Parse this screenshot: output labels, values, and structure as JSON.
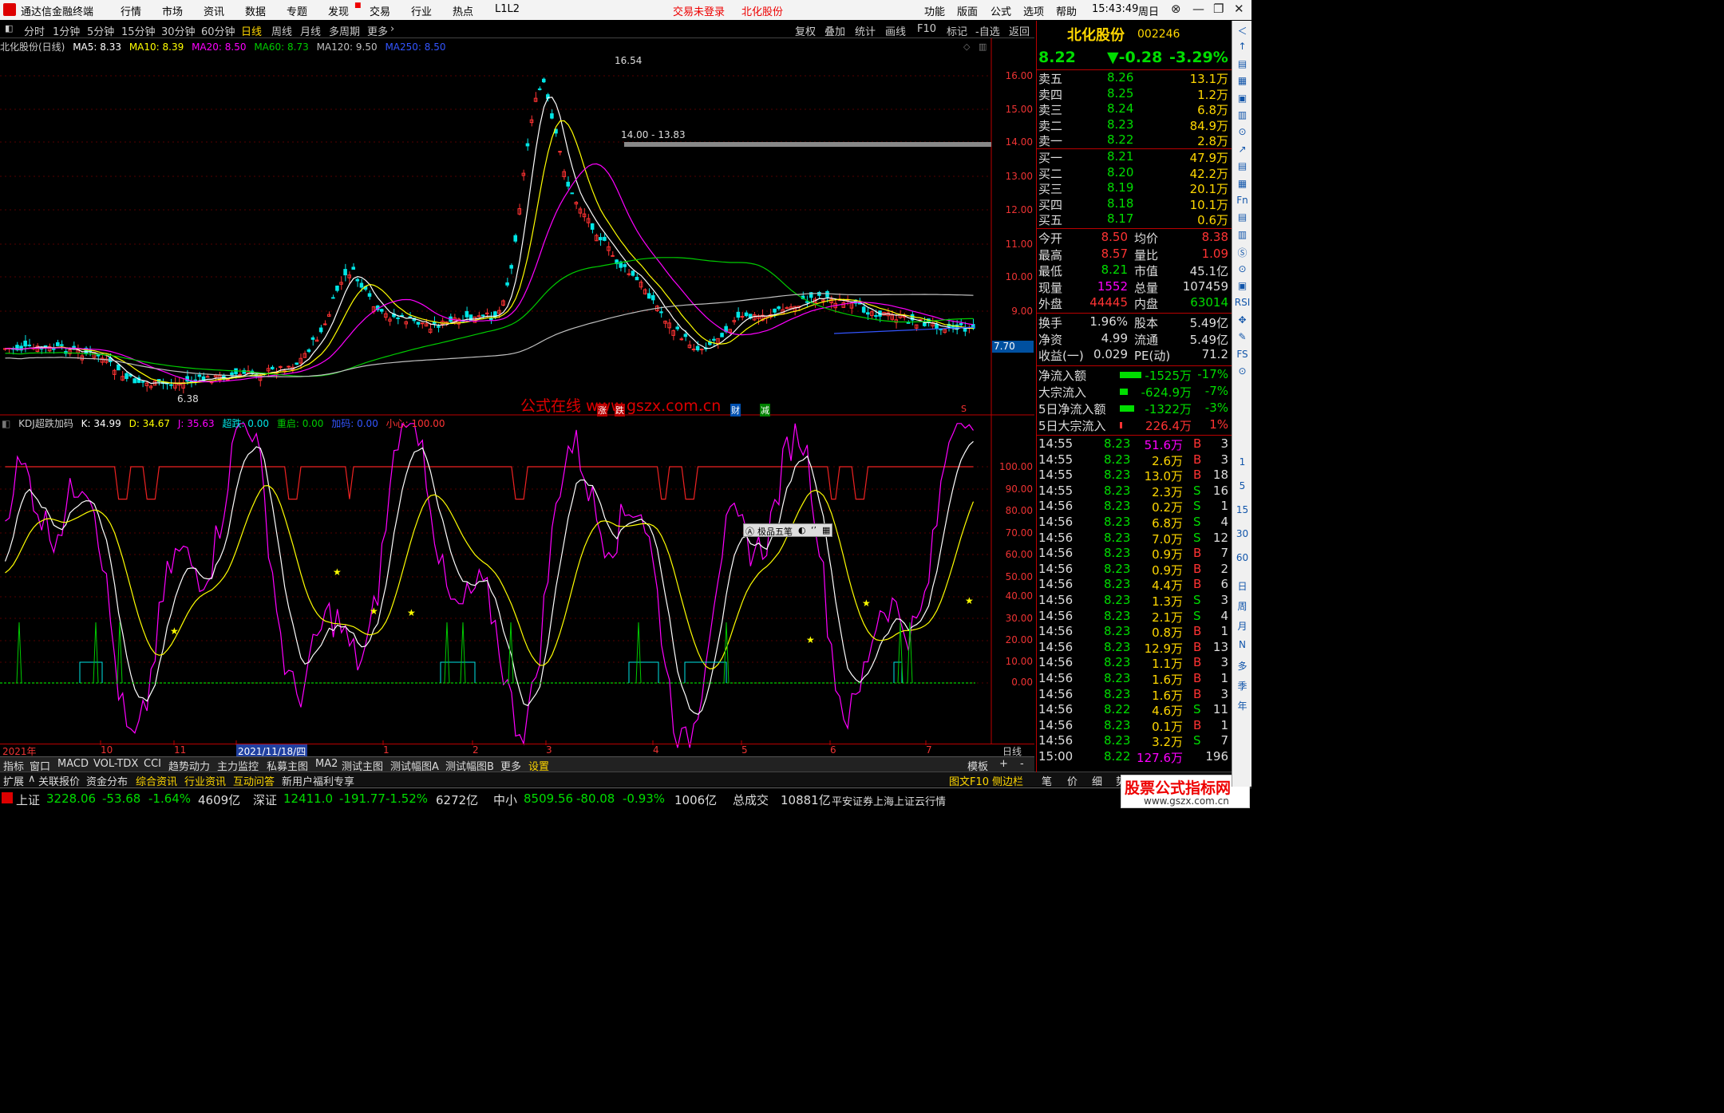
{
  "menu": {
    "app_title": "通达信金融终端",
    "items": [
      "行情",
      "市场",
      "资讯",
      "数据",
      "专题",
      "发现",
      "交易",
      "行业",
      "热点",
      "L1L2"
    ],
    "login_status": "交易未登录",
    "stock": "北化股份",
    "right_items": [
      "功能",
      "版面",
      "公式",
      "选项",
      "帮助"
    ],
    "clock": "15:43:49",
    "weekday": "周日"
  },
  "periods": [
    "分时",
    "1分钟",
    "5分钟",
    "15分钟",
    "30分钟",
    "60分钟",
    "日线",
    "周线",
    "月线",
    "多周期",
    "更多"
  ],
  "active_period": "日线",
  "toolbar_right": [
    "复权",
    "叠加",
    "统计",
    "画线",
    "F10",
    "标记",
    "-自选",
    "返回"
  ],
  "ma_legend": {
    "title": "北化股份(日线)",
    "ma5": "MA5: 8.33",
    "ma10": "MA10: 8.39",
    "ma20": "MA20: 8.50",
    "ma60": "MA60: 8.73",
    "ma120": "MA120: 9.50",
    "ma250": "MA250: 8.50"
  },
  "annotations": {
    "high": "16.54",
    "low": "6.38",
    "range": "14.00 - 13.83",
    "price_tag": "7.70",
    "watermark": "公式在线 www.gszx.com.cn",
    "ime": "极品五笔"
  },
  "markers": [
    "涨",
    "跌",
    "财",
    "减",
    "S"
  ],
  "price_axis": [
    "16.00",
    "15.00",
    "14.00",
    "13.00",
    "12.00",
    "11.00",
    "10.00",
    "9.00"
  ],
  "kdj_legend": {
    "name": "KDJ超跌加码",
    "k": "K: 34.99",
    "d": "D: 34.67",
    "j": "J: 35.63",
    "cd": "超跌: 0.00",
    "cq": "重启: 0.00",
    "jm": "加码: 0.00",
    "xx": "小心: 100.00"
  },
  "kdj_axis": [
    "100.00",
    "90.00",
    "80.00",
    "70.00",
    "60.00",
    "50.00",
    "40.00",
    "30.00",
    "20.00",
    "10.00",
    "0.00"
  ],
  "dates": [
    "2021年",
    "10",
    "11",
    "2021/11/18/四",
    "1",
    "2",
    "3",
    "4",
    "5",
    "6",
    "7"
  ],
  "date_right": "日线",
  "tabs1": [
    "指标",
    "窗口",
    "MACD",
    "VOL-TDX",
    "CCI",
    "趋势动力",
    "主力监控",
    "私募主图",
    "MA2",
    "测试主图",
    "测试幅图A",
    "测试幅图B",
    "更多",
    "设置"
  ],
  "tabs1_right": [
    "模板",
    "+",
    "-"
  ],
  "tabs2": [
    "扩展",
    "关联报价",
    "资金分布",
    "综合资讯",
    "行业资讯",
    "互动问答",
    "新用户福利专享"
  ],
  "tabs2_right": [
    "图文F10",
    "侧边栏",
    "笔",
    "价",
    "细",
    "势"
  ],
  "quote": {
    "name": "北化股份",
    "code": "002246",
    "price": "8.22",
    "change": "▼-0.28",
    "pct": "-3.29%"
  },
  "asks": [
    {
      "l": "卖五",
      "p": "8.26",
      "v": "13.1万"
    },
    {
      "l": "卖四",
      "p": "8.25",
      "v": "1.2万"
    },
    {
      "l": "卖三",
      "p": "8.24",
      "v": "6.8万"
    },
    {
      "l": "卖二",
      "p": "8.23",
      "v": "84.9万"
    },
    {
      "l": "卖一",
      "p": "8.22",
      "v": "2.8万"
    }
  ],
  "bids": [
    {
      "l": "买一",
      "p": "8.21",
      "v": "47.9万"
    },
    {
      "l": "买二",
      "p": "8.20",
      "v": "42.2万"
    },
    {
      "l": "买三",
      "p": "8.19",
      "v": "20.1万"
    },
    {
      "l": "买四",
      "p": "8.18",
      "v": "10.1万"
    },
    {
      "l": "买五",
      "p": "8.17",
      "v": "0.6万"
    }
  ],
  "stats": [
    {
      "a": "今开",
      "b": "8.50",
      "c": "均价",
      "d": "8.38"
    },
    {
      "a": "最高",
      "b": "8.57",
      "c": "量比",
      "d": "1.09"
    },
    {
      "a": "最低",
      "b": "8.21",
      "c": "市值",
      "d": "45.1亿"
    },
    {
      "a": "现量",
      "b": "1552",
      "c": "总量",
      "d": "107459"
    },
    {
      "a": "外盘",
      "b": "44445",
      "c": "内盘",
      "d": "63014"
    }
  ],
  "stats2": [
    {
      "a": "换手",
      "b": "1.96%",
      "c": "股本",
      "d": "5.49亿"
    },
    {
      "a": "净资",
      "b": "4.99",
      "c": "流通",
      "d": "5.49亿"
    },
    {
      "a": "收益(一)",
      "b": "0.029",
      "c": "PE(动)",
      "d": "71.2"
    }
  ],
  "flows": [
    {
      "a": "净流入额",
      "b": "-1525万",
      "c": "-17%"
    },
    {
      "a": "大宗流入",
      "b": "-624.9万",
      "c": "-7%"
    },
    {
      "a": "5日净流入额",
      "b": "-1322万",
      "c": "-3%"
    },
    {
      "a": "5日大宗流入",
      "b": "226.4万",
      "c": "1%"
    }
  ],
  "ticks": [
    {
      "t": "14:55",
      "p": "8.23",
      "v": "51.6万",
      "s": "B",
      "n": "3"
    },
    {
      "t": "14:55",
      "p": "8.23",
      "v": "2.6万",
      "s": "B",
      "n": "3"
    },
    {
      "t": "14:55",
      "p": "8.23",
      "v": "13.0万",
      "s": "B",
      "n": "18"
    },
    {
      "t": "14:55",
      "p": "8.23",
      "v": "2.3万",
      "s": "S",
      "n": "16"
    },
    {
      "t": "14:56",
      "p": "8.23",
      "v": "0.2万",
      "s": "S",
      "n": "1"
    },
    {
      "t": "14:56",
      "p": "8.23",
      "v": "6.8万",
      "s": "S",
      "n": "4"
    },
    {
      "t": "14:56",
      "p": "8.23",
      "v": "7.0万",
      "s": "S",
      "n": "12"
    },
    {
      "t": "14:56",
      "p": "8.23",
      "v": "0.9万",
      "s": "B",
      "n": "7"
    },
    {
      "t": "14:56",
      "p": "8.23",
      "v": "0.9万",
      "s": "B",
      "n": "2"
    },
    {
      "t": "14:56",
      "p": "8.23",
      "v": "4.4万",
      "s": "B",
      "n": "6"
    },
    {
      "t": "14:56",
      "p": "8.23",
      "v": "1.3万",
      "s": "S",
      "n": "3"
    },
    {
      "t": "14:56",
      "p": "8.23",
      "v": "2.1万",
      "s": "S",
      "n": "4"
    },
    {
      "t": "14:56",
      "p": "8.23",
      "v": "0.8万",
      "s": "B",
      "n": "1"
    },
    {
      "t": "14:56",
      "p": "8.23",
      "v": "12.9万",
      "s": "B",
      "n": "13"
    },
    {
      "t": "14:56",
      "p": "8.23",
      "v": "1.1万",
      "s": "B",
      "n": "3"
    },
    {
      "t": "14:56",
      "p": "8.23",
      "v": "1.6万",
      "s": "B",
      "n": "1"
    },
    {
      "t": "14:56",
      "p": "8.23",
      "v": "1.6万",
      "s": "B",
      "n": "3"
    },
    {
      "t": "14:56",
      "p": "8.22",
      "v": "4.6万",
      "s": "S",
      "n": "11"
    },
    {
      "t": "14:56",
      "p": "8.23",
      "v": "0.1万",
      "s": "B",
      "n": "1"
    },
    {
      "t": "14:56",
      "p": "8.23",
      "v": "3.2万",
      "s": "S",
      "n": "7"
    },
    {
      "t": "15:00",
      "p": "8.22",
      "v": "127.6万",
      "s": "",
      "n": "196"
    }
  ],
  "indices": {
    "sh_label": "上证",
    "sh": "3228.06",
    "sh_chg": "-53.68",
    "sh_pct": "-1.64%",
    "sh_amt": "4609亿",
    "sz_label": "深证",
    "sz": "12411.0",
    "sz_chg": "-191.77",
    "sz_pct": "-1.52%",
    "sz_amt": "6272亿",
    "zx_label": "中小",
    "zx": "8509.56",
    "zx_chg": "-80.08",
    "zx_pct": "-0.93%",
    "zx_amt": "1006亿",
    "total_label": "总成交",
    "total": "10881亿",
    "server": "平安证券上海上证云行情"
  },
  "logo": "股票公式指标网",
  "logo_url": "www.gszx.com.cn",
  "sidebar_nums": [
    "1",
    "5",
    "15",
    "30",
    "60"
  ],
  "sidebar_chars": [
    "日",
    "周",
    "月",
    "N",
    "多",
    "季",
    "年"
  ],
  "colors": {
    "up": "#ff3333",
    "down": "#00e6e6",
    "ma5": "#ffffff",
    "ma10": "#ffff00",
    "ma20": "#ff00ff",
    "ma60": "#00cc00",
    "ma120": "#c0c0c0",
    "ma250": "#3355ff"
  }
}
